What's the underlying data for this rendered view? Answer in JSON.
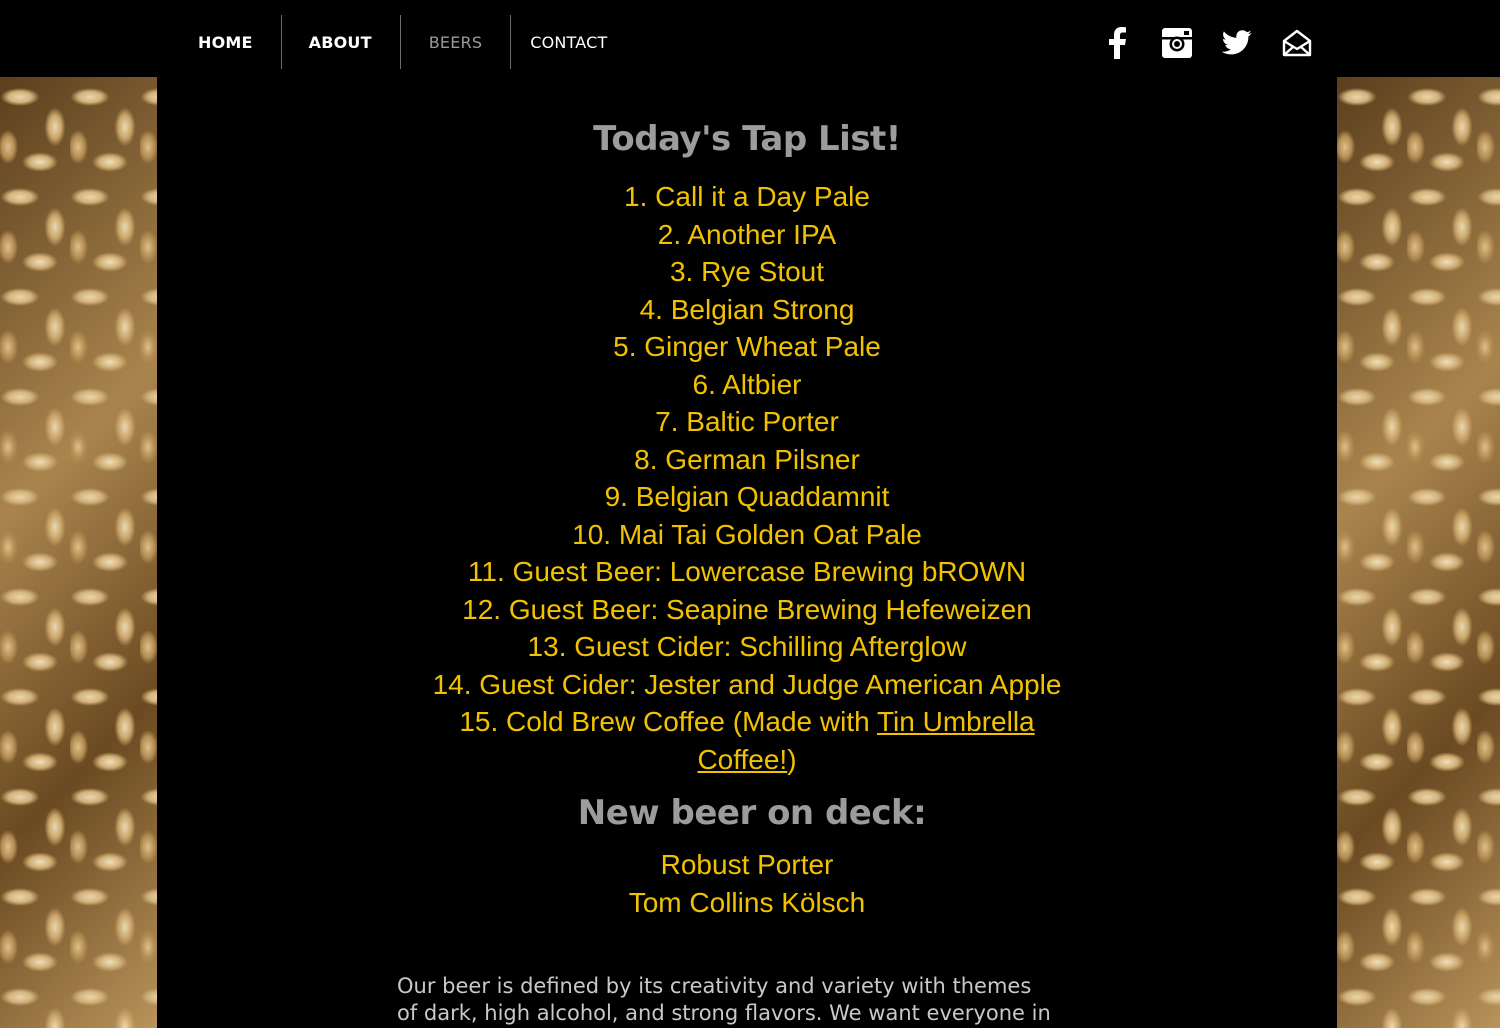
{
  "nav": {
    "items": [
      {
        "label": "HOME"
      },
      {
        "label": "ABOUT"
      },
      {
        "label": "BEERS"
      },
      {
        "label": "CONTACT"
      }
    ],
    "active": "BEERS"
  },
  "social": {
    "icons": [
      "facebook-icon",
      "instagram-icon",
      "twitter-icon",
      "mail-icon"
    ]
  },
  "tap_list": {
    "title": "Today's Tap List!",
    "items": [
      "1. Call it a Day Pale",
      "2. Another IPA",
      "3. Rye Stout",
      "4. Belgian Strong",
      "5. Ginger Wheat Pale",
      "6. Altbier",
      "7. Baltic Porter",
      "8. German Pilsner",
      "9. Belgian Quaddamnit",
      "10. Mai Tai Golden Oat Pale",
      "11. Guest Beer: Lowercase Brewing bROWN",
      "12. Guest Beer: Seapine Brewing Hefeweizen",
      "13. Guest Cider: Schilling Afterglow",
      "14. Guest Cider: Jester and Judge American Apple"
    ],
    "last_item": {
      "prefix": "15. Cold Brew Coffee (Made with ",
      "link": "Tin Umbrella Coffee!",
      "suffix": ")"
    }
  },
  "on_deck": {
    "title": "New beer on deck:",
    "items": [
      "Robust Porter",
      "Tom Collins Kölsch"
    ]
  },
  "description": "Our beer is defined by its creativity and variety with themes of dark, high alcohol, and strong flavors. We want everyone in",
  "colors": {
    "accent_yellow": "#f2c200",
    "heading_gray": "#9c9c9c",
    "background": "#000000"
  }
}
